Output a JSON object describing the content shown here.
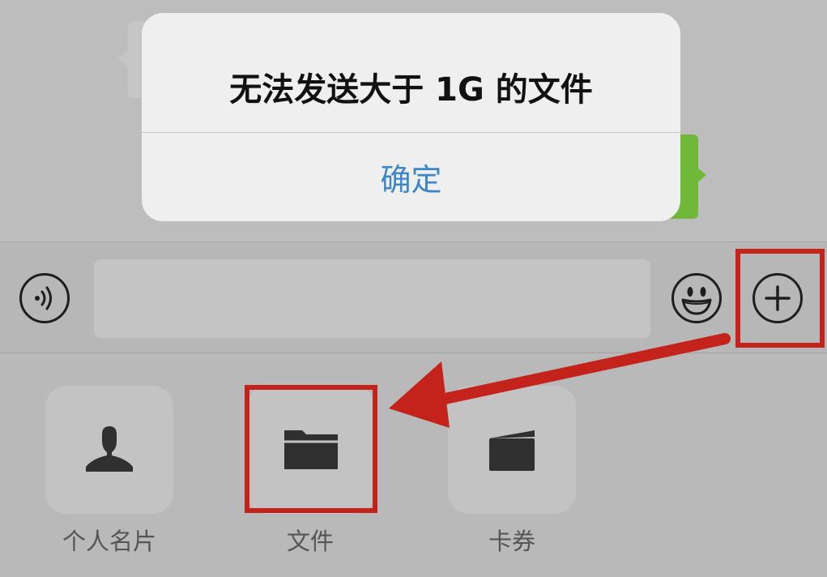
{
  "alert": {
    "message": "无法发送大于 1G 的文件",
    "confirm_label": "确定"
  },
  "input_bar": {
    "text_value": "",
    "voice_icon": "voice-wave-icon",
    "emoji_icon": "smiley-face-icon",
    "plus_icon": "plus-circle-icon"
  },
  "panel": {
    "items": [
      {
        "label": "个人名片",
        "icon": "person-icon"
      },
      {
        "label": "文件",
        "icon": "folder-icon"
      },
      {
        "label": "卡券",
        "icon": "wallet-icon"
      }
    ]
  },
  "colors": {
    "annotation_red": "#c4231c",
    "alert_button_blue": "#3d87c8",
    "chat_bubble_green": "#6fb83a"
  }
}
